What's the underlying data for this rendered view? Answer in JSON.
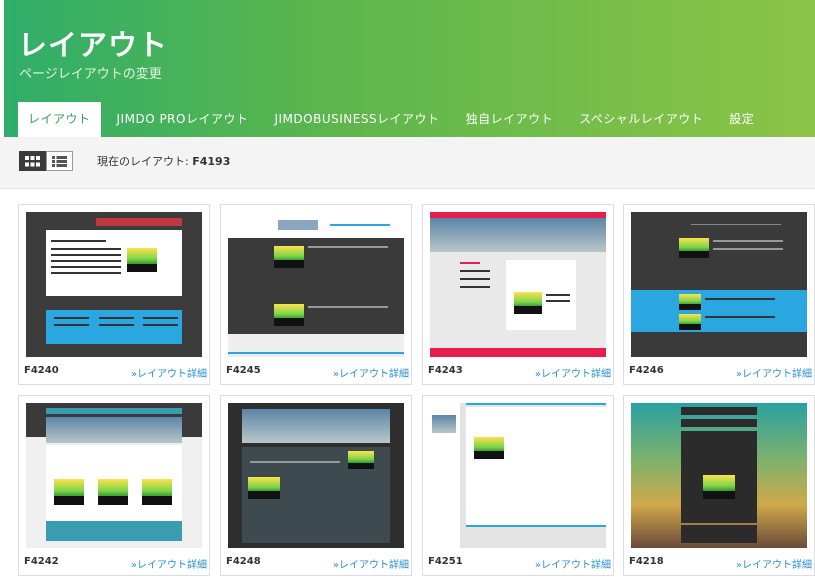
{
  "header": {
    "title": "レイアウト",
    "subtitle": "ページレイアウトの変更",
    "tabs": [
      {
        "label": "レイアウト",
        "active": true
      },
      {
        "label": "JIMDO PROレイアウト",
        "active": false
      },
      {
        "label": "JIMDOBUSINESSレイアウト",
        "active": false
      },
      {
        "label": "独自レイアウト",
        "active": false
      },
      {
        "label": "スペシャルレイアウト",
        "active": false
      },
      {
        "label": "設定",
        "active": false
      }
    ]
  },
  "toolbar": {
    "current_label": "現在のレイアウト:",
    "current_value": "F4193",
    "grid_view_icon": "grid-icon",
    "list_view_icon": "list-icon"
  },
  "layouts": [
    {
      "name": "F4240",
      "link": "»レイアウト詳細"
    },
    {
      "name": "F4245",
      "link": "»レイアウト詳細"
    },
    {
      "name": "F4243",
      "link": "»レイアウト詳細"
    },
    {
      "name": "F4246",
      "link": "»レイアウト詳細"
    },
    {
      "name": "F4242",
      "link": "»レイアウト詳細"
    },
    {
      "name": "F4248",
      "link": "»レイアウト詳細"
    },
    {
      "name": "F4251",
      "link": "»レイアウト詳細"
    },
    {
      "name": "F4218",
      "link": "»レイアウト詳細"
    }
  ],
  "colors": {
    "header_start": "#2fae6a",
    "header_end": "#8cc447",
    "link": "#2a8fd0",
    "active_tab_text": "#3a9d5c"
  }
}
